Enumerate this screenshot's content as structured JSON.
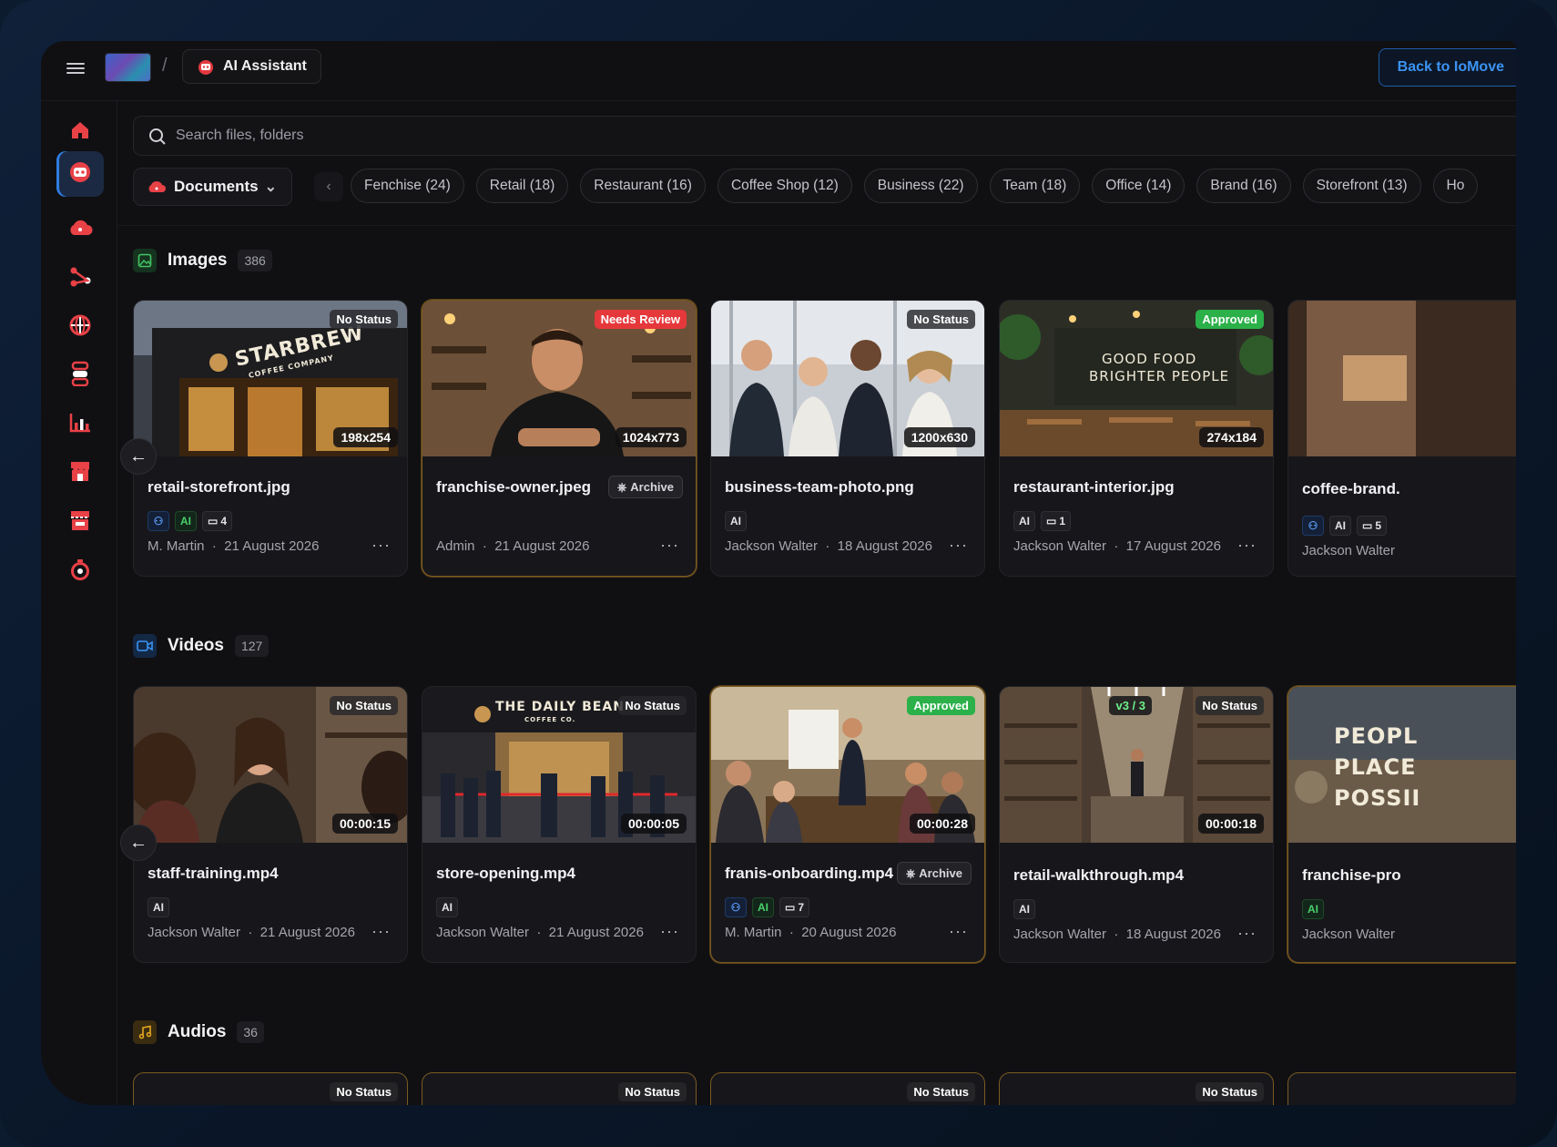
{
  "topbar": {
    "breadcrumb_sep": "/",
    "app_name": "AI Assistant",
    "back_label": "Back to IoMove"
  },
  "search": {
    "placeholder": "Search files, folders"
  },
  "filter": {
    "type_label": "Documents",
    "chips": [
      "Fenchise (24)",
      "Retail (18)",
      "Restaurant (16)",
      "Coffee Shop (12)",
      "Business (22)",
      "Team (18)",
      "Office (14)",
      "Brand (16)",
      "Storefront (13)",
      "Ho"
    ]
  },
  "colors": {
    "accent": "#3c93f2",
    "review": "#e5383b",
    "approved": "#2bb04a",
    "selected_border": "#7a5a22"
  },
  "sidebar": {
    "icons": [
      "home-icon",
      "ai-assistant-icon",
      "cloud-icon",
      "share-icon",
      "globe-icon",
      "network-icon",
      "chart-icon",
      "store-icon",
      "shop-icon",
      "timer-icon"
    ]
  },
  "images": {
    "title": "Images",
    "count": "386",
    "cards": [
      {
        "name": "retail-storefront.jpg",
        "status": "No Status",
        "dims": "198x254",
        "tag_comment": "4",
        "author": "M. Martin",
        "date": "21 August 2026",
        "sign": "STARBREW",
        "sign_sub": "COFFEE COMPANY"
      },
      {
        "name": "franchise-owner.jpeg",
        "status": "Needs Review",
        "dims": "1024x773",
        "archive": "Archive",
        "author": "Admin",
        "date": "21 August 2026"
      },
      {
        "name": "business-team-photo.png",
        "status": "No Status",
        "dims": "1200x630",
        "tag_ai": "AI",
        "author": "Jackson Walter",
        "date": "18 August 2026"
      },
      {
        "name": "restaurant-interior.jpg",
        "status": "Approved",
        "dims": "274x184",
        "tag_ai": "AI",
        "tag_comment": "1",
        "author": "Jackson Walter",
        "date": "17 August 2026",
        "sign1": "GOOD FOOD",
        "sign2": "BRIGHTER PEOPLE"
      },
      {
        "name": "coffee-brand.",
        "tag_ai": "AI",
        "tag_comment": "5",
        "author": "Jackson Walter"
      }
    ]
  },
  "videos": {
    "title": "Videos",
    "count": "127",
    "cards": [
      {
        "name": "staff-training.mp4",
        "status": "No Status",
        "duration": "00:00:15",
        "tag_ai": "AI",
        "author": "Jackson Walter",
        "date": "21 August 2026"
      },
      {
        "name": "store-opening.mp4",
        "status": "No Status",
        "duration": "00:00:05",
        "tag_ai": "AI",
        "author": "Jackson Walter",
        "date": "21 August 2026",
        "sign": "THE DAILY BEAN",
        "sign_sub": "COFFEE CO."
      },
      {
        "name": "franis-onboarding.mp4",
        "status": "Approved",
        "duration": "00:00:28",
        "archive": "Archive",
        "tag_ai": "AI",
        "tag_comment": "7",
        "author": "M. Martin",
        "date": "20 August 2026"
      },
      {
        "name": "retail-walkthrough.mp4",
        "status": "No Status",
        "version": "v3 / 3",
        "duration": "00:00:18",
        "tag_ai": "AI",
        "author": "Jackson Walter",
        "date": "18 August 2026"
      },
      {
        "name": "franchise-pro",
        "tag_ai": "AI",
        "author": "Jackson Walter",
        "poster1": "PEOPL",
        "poster2": "PLACE",
        "poster3": "POSSII"
      }
    ]
  },
  "audios": {
    "title": "Audios",
    "count": "36",
    "cards": [
      {
        "status": "No Status"
      },
      {
        "status": "No Status"
      },
      {
        "status": "No Status"
      },
      {
        "status": "No Status"
      }
    ]
  },
  "misc": {
    "meta_sep": "·",
    "more": "···",
    "ai_short": "AI"
  }
}
